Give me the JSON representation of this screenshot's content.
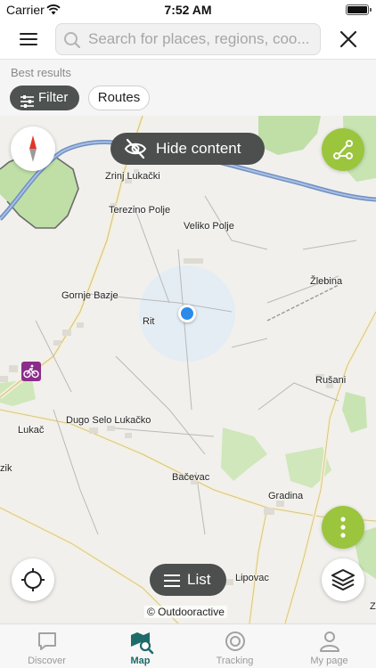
{
  "status_bar": {
    "carrier": "Carrier",
    "time": "7:52 AM"
  },
  "search": {
    "placeholder": "Search for places, regions, coo..."
  },
  "results": {
    "label": "Best results",
    "filter_label": "Filter",
    "routes_label": "Routes"
  },
  "map": {
    "hide_content_label": "Hide content",
    "list_label": "List",
    "attribution": "© Outdooractive",
    "places": {
      "zrinj_lukacki": "Zrinj Lukački",
      "terezino_polje": "Terezino Polje",
      "veliko_polje": "Veliko Polje",
      "zlebina": "Žlebina",
      "gornje_bazje": "Gornje Bazje",
      "rit": "Rit",
      "rusani": "Rušani",
      "dugo_selo": "Dugo Selo Lukačko",
      "lukac": "Lukač",
      "zik": "zik",
      "bacevac": "Bačevac",
      "gradina": "Gradina",
      "lipovac": "Lipovac",
      "z": "Z"
    },
    "colors": {
      "river": "#6f8fc4",
      "forest": "#bfdfa6",
      "accent_green": "#9bc53d",
      "location": "#2b8ae8"
    }
  },
  "tabbar": {
    "tabs": [
      {
        "label": "Discover",
        "icon": "chat-bubble-icon"
      },
      {
        "label": "Map",
        "icon": "map-search-icon"
      },
      {
        "label": "Tracking",
        "icon": "record-icon"
      },
      {
        "label": "My page",
        "icon": "person-icon"
      }
    ]
  }
}
